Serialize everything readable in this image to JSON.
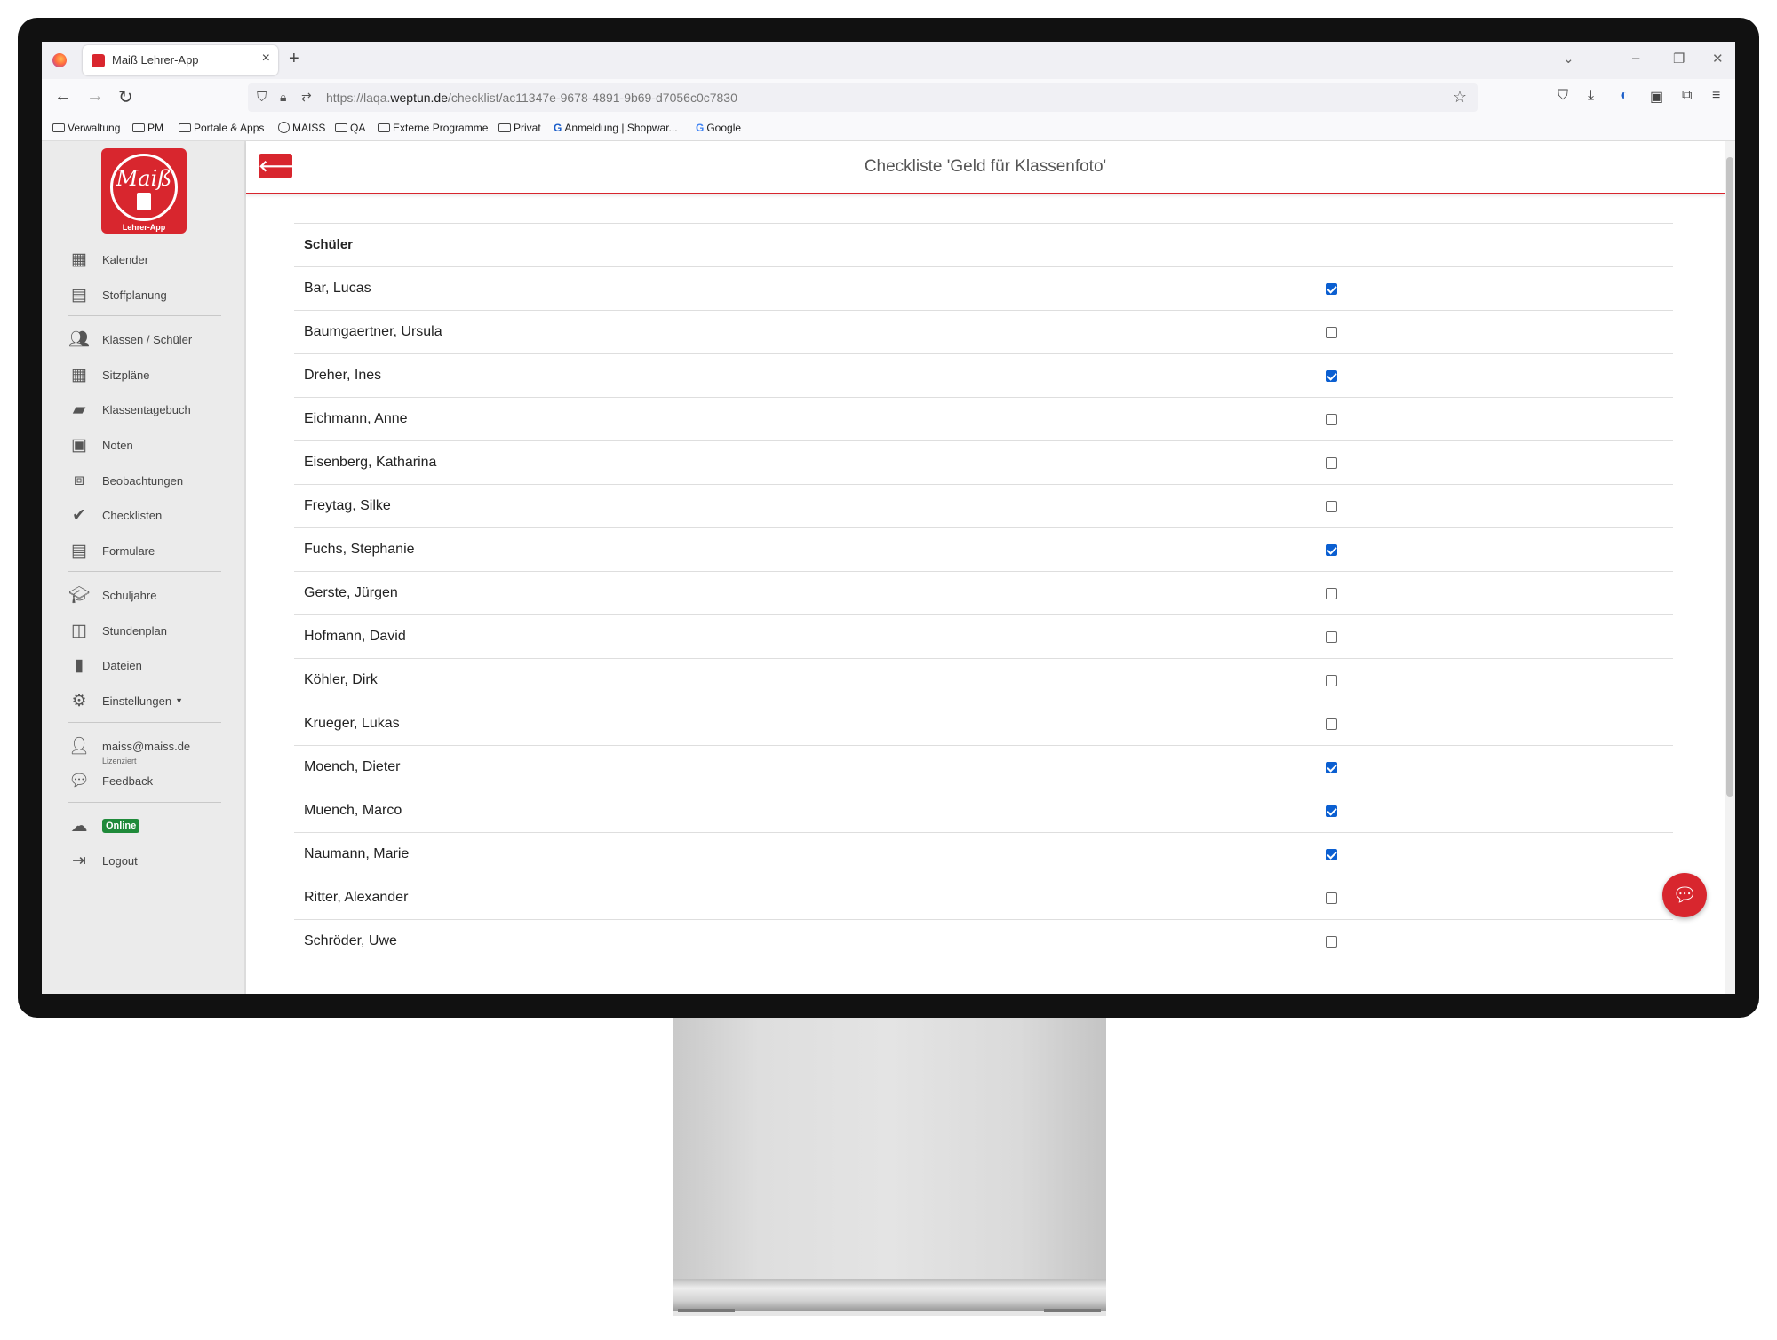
{
  "browser": {
    "tab_title": "Maiß Lehrer-App",
    "url_prefix": "https://laqa.",
    "url_domain": "weptun.de",
    "url_path": "/checklist/ac11347e-9678-4891-9b69-d7056c0c7830",
    "bookmarks": [
      "Verwaltung",
      "PM",
      "Portale & Apps",
      "MAISS",
      "QA",
      "Externe Programme",
      "Privat",
      "Anmeldung | Shopwar...",
      "Google"
    ]
  },
  "sidebar": {
    "logo_text": "Maiß",
    "logo_caption": "Lehrer-App",
    "items": [
      {
        "label": "Kalender",
        "icon": "calendar-icon"
      },
      {
        "label": "Stoffplanung",
        "icon": "archive-icon"
      },
      {
        "label": "Klassen / Schüler",
        "icon": "users-icon"
      },
      {
        "label": "Sitzpläne",
        "icon": "grid-icon"
      },
      {
        "label": "Klassentagebuch",
        "icon": "book-icon"
      },
      {
        "label": "Noten",
        "icon": "grades-icon"
      },
      {
        "label": "Beobachtungen",
        "icon": "binoculars-icon"
      },
      {
        "label": "Checklisten",
        "icon": "check-circle-icon"
      },
      {
        "label": "Formulare",
        "icon": "form-icon"
      },
      {
        "label": "Schuljahre",
        "icon": "graduation-cap-icon"
      },
      {
        "label": "Stundenplan",
        "icon": "columns-icon"
      },
      {
        "label": "Dateien",
        "icon": "file-icon"
      },
      {
        "label": "Einstellungen",
        "icon": "gear-icon"
      },
      {
        "label": "maiss@maiss.de",
        "icon": "user-icon"
      },
      {
        "label": "Feedback",
        "icon": "comment-icon"
      },
      {
        "label": "Online",
        "icon": "cloud-icon"
      },
      {
        "label": "Logout",
        "icon": "logout-icon"
      }
    ],
    "license_text": "Lizenziert"
  },
  "header": {
    "title": "Checkliste 'Geld für Klassenfoto'"
  },
  "table": {
    "column_header": "Schüler",
    "rows": [
      {
        "name": "Bar, Lucas",
        "checked": true
      },
      {
        "name": "Baumgaertner, Ursula",
        "checked": false
      },
      {
        "name": "Dreher, Ines",
        "checked": true
      },
      {
        "name": "Eichmann, Anne",
        "checked": false
      },
      {
        "name": "Eisenberg, Katharina",
        "checked": false
      },
      {
        "name": "Freytag, Silke",
        "checked": false
      },
      {
        "name": "Fuchs, Stephanie",
        "checked": true
      },
      {
        "name": "Gerste, Jürgen",
        "checked": false
      },
      {
        "name": "Hofmann, David",
        "checked": false
      },
      {
        "name": "Köhler, Dirk",
        "checked": false
      },
      {
        "name": "Krueger, Lukas",
        "checked": false
      },
      {
        "name": "Moench, Dieter",
        "checked": true
      },
      {
        "name": "Muench, Marco",
        "checked": true
      },
      {
        "name": "Naumann, Marie",
        "checked": true
      },
      {
        "name": "Ritter, Alexander",
        "checked": false
      },
      {
        "name": "Schröder, Uwe",
        "checked": false
      }
    ]
  },
  "colors": {
    "accent": "#d8262e",
    "checkbox": "#0b5fd1",
    "online": "#1f8a3a"
  }
}
